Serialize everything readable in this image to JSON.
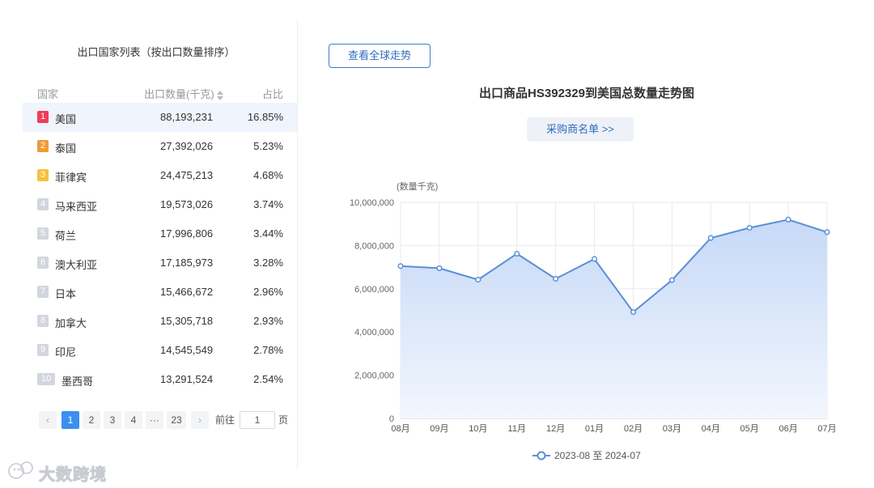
{
  "list": {
    "title": "出口国家列表（按出口数量排序）",
    "headers": {
      "country": "国家",
      "qty": "出口数量(千克)",
      "pct": "占比"
    },
    "rows": [
      {
        "rank": "1",
        "country": "美国",
        "qty": "88,193,231",
        "pct": "16.85%"
      },
      {
        "rank": "2",
        "country": "泰国",
        "qty": "27,392,026",
        "pct": "5.23%"
      },
      {
        "rank": "3",
        "country": "菲律宾",
        "qty": "24,475,213",
        "pct": "4.68%"
      },
      {
        "rank": "4",
        "country": "马来西亚",
        "qty": "19,573,026",
        "pct": "3.74%"
      },
      {
        "rank": "5",
        "country": "荷兰",
        "qty": "17,996,806",
        "pct": "3.44%"
      },
      {
        "rank": "6",
        "country": "澳大利亚",
        "qty": "17,185,973",
        "pct": "3.28%"
      },
      {
        "rank": "7",
        "country": "日本",
        "qty": "15,466,672",
        "pct": "2.96%"
      },
      {
        "rank": "8",
        "country": "加拿大",
        "qty": "15,305,718",
        "pct": "2.93%"
      },
      {
        "rank": "9",
        "country": "印尼",
        "qty": "14,545,549",
        "pct": "2.78%"
      },
      {
        "rank": "10",
        "country": "墨西哥",
        "qty": "13,291,524",
        "pct": "2.54%"
      }
    ]
  },
  "pagination": {
    "prev": "‹",
    "next": "›",
    "pages": [
      "1",
      "2",
      "3",
      "4",
      "···",
      "23"
    ],
    "current": "1",
    "goto_prefix": "前往",
    "goto_value": "1",
    "goto_suffix": "页"
  },
  "buttons": {
    "global_trend": "查看全球走势",
    "buyer_list": "采购商名单 >>"
  },
  "chart_data": {
    "type": "area",
    "title": "出口商品HS392329到美国总数量走势图",
    "ylabel": "(数量千克)",
    "x": [
      "08月",
      "09月",
      "10月",
      "11月",
      "12月",
      "01月",
      "02月",
      "03月",
      "04月",
      "05月",
      "06月",
      "07月"
    ],
    "y_ticks": [
      "0",
      "2,000,000",
      "4,000,000",
      "6,000,000",
      "8,000,000",
      "10,000,000"
    ],
    "ylim": [
      0,
      10000000
    ],
    "series": [
      {
        "name": "2023-08 至 2024-07",
        "values": [
          7050000,
          6950000,
          6420000,
          7620000,
          6460000,
          7380000,
          4920000,
          6400000,
          8350000,
          8820000,
          9200000,
          8620000
        ]
      }
    ],
    "grid": true,
    "legend": "bottom",
    "colors": {
      "line": "#5b8fd6",
      "area_top": "#c6d9f7",
      "area_bottom": "#f2f6fd",
      "grid": "#e8eaee"
    }
  },
  "watermark": {
    "text": "大数跨境"
  }
}
